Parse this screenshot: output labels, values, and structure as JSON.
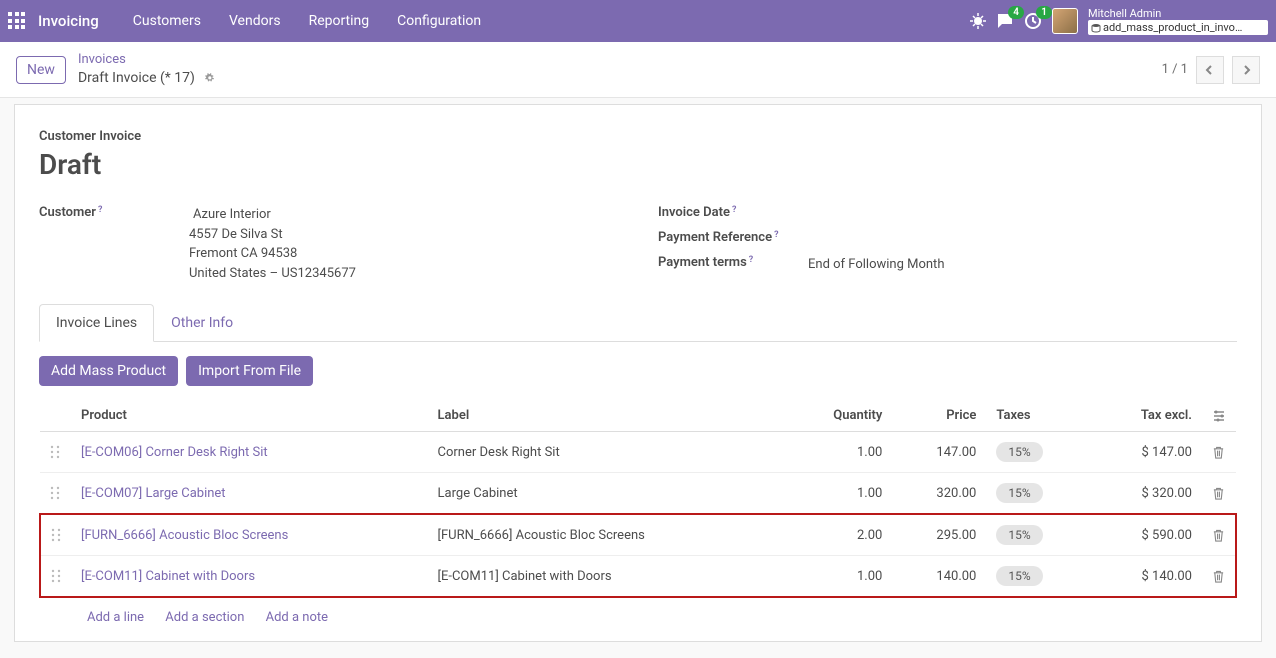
{
  "navbar": {
    "brand": "Invoicing",
    "links": [
      "Customers",
      "Vendors",
      "Reporting",
      "Configuration"
    ],
    "messaging_count": "4",
    "activity_count": "1",
    "username": "Mitchell Admin",
    "dbname": "add_mass_product_in_invo…"
  },
  "breadcrumb": {
    "new_label": "New",
    "parent": "Invoices",
    "current": "Draft Invoice (* 17)",
    "pager": "1 / 1"
  },
  "form": {
    "subtitle": "Customer Invoice",
    "title": "Draft",
    "customer_label": "Customer",
    "customer_name": "Azure Interior",
    "addr1": "4557 De Silva St",
    "addr2": "Fremont CA 94538",
    "addr3": "United States – US12345677",
    "invoice_date_label": "Invoice Date",
    "payment_ref_label": "Payment Reference",
    "payment_terms_label": "Payment terms",
    "payment_terms_value": "End of Following Month"
  },
  "tabs": {
    "invoice_lines": "Invoice Lines",
    "other_info": "Other Info"
  },
  "buttons": {
    "add_mass": "Add Mass Product",
    "import_file": "Import From File"
  },
  "table": {
    "headers": {
      "product": "Product",
      "label": "Label",
      "quantity": "Quantity",
      "price": "Price",
      "taxes": "Taxes",
      "tax_excl": "Tax excl."
    },
    "rows": [
      {
        "product": "[E-COM06] Corner Desk Right Sit",
        "label": "Corner Desk Right Sit",
        "qty": "1.00",
        "price": "147.00",
        "tax": "15%",
        "subtotal": "$ 147.00",
        "hl": false
      },
      {
        "product": "[E-COM07] Large Cabinet",
        "label": "Large Cabinet",
        "qty": "1.00",
        "price": "320.00",
        "tax": "15%",
        "subtotal": "$ 320.00",
        "hl": false
      },
      {
        "product": "[FURN_6666] Acoustic Bloc Screens",
        "label": "[FURN_6666] Acoustic Bloc Screens",
        "qty": "2.00",
        "price": "295.00",
        "tax": "15%",
        "subtotal": "$ 590.00",
        "hl": true
      },
      {
        "product": "[E-COM11] Cabinet with Doors",
        "label": "[E-COM11] Cabinet with Doors",
        "qty": "1.00",
        "price": "140.00",
        "tax": "15%",
        "subtotal": "$ 140.00",
        "hl": true
      }
    ],
    "footer": {
      "add_line": "Add a line",
      "add_section": "Add a section",
      "add_note": "Add a note"
    }
  }
}
